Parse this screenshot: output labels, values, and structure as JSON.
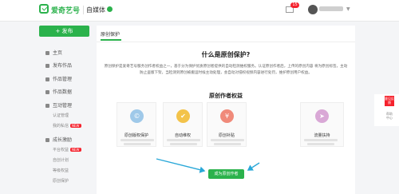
{
  "header": {
    "logo_text": "爱奇艺号",
    "logo_sub": "自媒体",
    "mail_badge": "15"
  },
  "sidebar": {
    "publish_label": "+ 发布",
    "items": [
      {
        "label": "主页"
      },
      {
        "label": "发布作品"
      },
      {
        "label": "作品管理"
      },
      {
        "label": "作品数据"
      },
      {
        "label": "互动管理"
      }
    ],
    "sub_items_1": [
      {
        "label": "认证管理"
      },
      {
        "label": "我的私信",
        "tag": "NEW"
      }
    ],
    "growth": {
      "label": "成长激励"
    },
    "sub_items_2": [
      {
        "label": "平台权益",
        "tag": "NEW"
      },
      {
        "label": "自创计划"
      },
      {
        "label": "等级权益"
      },
      {
        "label": "原创保护"
      }
    ]
  },
  "main": {
    "tab": "原创保护",
    "title": "什么是原创保护?",
    "description": "原创保护是爱奇艺号服务创作者权益之一，基于分为保护优质原创者提供的自动检测维权服务。认证原创作者后，上传的原创内容 将为原创标签，主动防止盗版下架，当检测到原创被搬运时候主动处理，会自动对侵权视频内容进行处罚，维护原创用户权益。",
    "benefits_title": "原创作者权益",
    "cards": [
      {
        "title": "原创版权保护",
        "icon": "copyright-icon",
        "color": "#9fc9e9"
      },
      {
        "title": "自动维权",
        "icon": "shield-icon",
        "color": "#f3c34a"
      },
      {
        "title": "原创补贴",
        "icon": "money-icon",
        "color": "#f08a7a"
      },
      {
        "title": "流量扶持",
        "icon": "paper-plane-icon",
        "color": "#d9a8d6"
      }
    ],
    "cta_label": "成为原创作者"
  },
  "float": {
    "red_label": "意见反馈",
    "text": "帮助中心"
  },
  "colors": {
    "accent": "#2bb24c",
    "arrow": "#2aa8d8"
  }
}
